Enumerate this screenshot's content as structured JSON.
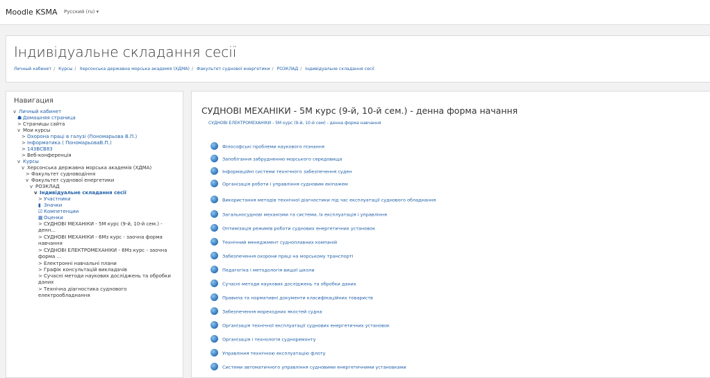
{
  "navbar": {
    "brand": "Moodle KSMA",
    "language": "Русский (ru) ▾"
  },
  "header": {
    "title": "Індивідуальне складання сесії",
    "breadcrumb": [
      "Личный кабинет",
      "Курсы",
      "Херсонська державна морська академія (ХДМА)",
      "Факультет суднової енергетики",
      "РОЗКЛАД",
      "Індивідуальне складання сесії"
    ]
  },
  "nav": {
    "title": "Навигация",
    "items": [
      {
        "label": "Личный кабинет"
      },
      {
        "label": "Домашняя страница"
      },
      {
        "label": "Страницы сайта"
      },
      {
        "label": "Мои курсы"
      },
      {
        "label": "Охорона праці в галузі (Пономарьова В.П.)"
      },
      {
        "label": "Інформатика ( ПономарьоваВ.П.)"
      },
      {
        "label": "143ВСВ83"
      },
      {
        "label": "Веб-конференція"
      },
      {
        "label": "Курсы"
      },
      {
        "label": "Херсонська державна морська академія (ХДМА)"
      },
      {
        "label": "Факультет судноводіння"
      },
      {
        "label": "Факультет суднової енергетики"
      },
      {
        "label": "РОЗКЛАД"
      },
      {
        "label": "Індивідуальне складання сесії"
      },
      {
        "label": "Участники"
      },
      {
        "label": "Значки"
      },
      {
        "label": "Компетенции"
      },
      {
        "label": "Оценки"
      },
      {
        "label": "СУДНОВІ МЕХАНІКИ - 5М курс (9-й, 10-й сем.) - денн..."
      },
      {
        "label": "СУДНОВІ МЕХАНІКИ - 6Мз курс - заочна форма навчання"
      },
      {
        "label": "СУДНОВІ ЕЛЕКТРОМЕХАНІКИ - 6Мз курс - заочна форма ..."
      },
      {
        "label": "Електронні навчальні плани"
      },
      {
        "label": "Графік консультацій викладачів"
      },
      {
        "label": "Сучасні методи наукових досліджень та обробки даних"
      },
      {
        "label": "Технічна діагностика суднового електрообладнання"
      }
    ]
  },
  "main": {
    "course_title": "СУДНОВІ МЕХАНІКИ - 5М курс (9-й, 10-й сем.) - денна форма начання",
    "subline": "СУДНОВІ ЕЛЕКТРОМЕХАНІКИ - 5М курс (9-й, 10-й сем) - денна форма навчання",
    "resources": [
      "Філософські проблеми наукового пізнання",
      "Запобігання забрудненню морського середовища",
      "Інформаційні системи технічного забезпечення суден",
      "Організація роботи і управління судновим екіпажем",
      "Використання методів технічної діагностики під час експлуатації суднового обладнання",
      "Загальносуднові механізми та системи, їх експлуатація і управління",
      "Оптимізація режимів роботи суднових енергетичних установок",
      "Технічний менеджмент судноплавних компаній",
      "Забезпечення охорони праці на морському транспорті",
      "Педагогіка і методологія вищої школи",
      "Сучасні методи наукових досліджень та обробки даних",
      "Правила та нормативні документи класифікаційних товариств",
      "Забезпечення мореходних якостей судна",
      "Організація технічної експлуатації суднових енергетичних установок",
      "Організація і технологія судноремонту",
      "Управління технічною експлуатацію флоту",
      "Системи автоматичного управління судновими енергетичними установками"
    ]
  }
}
